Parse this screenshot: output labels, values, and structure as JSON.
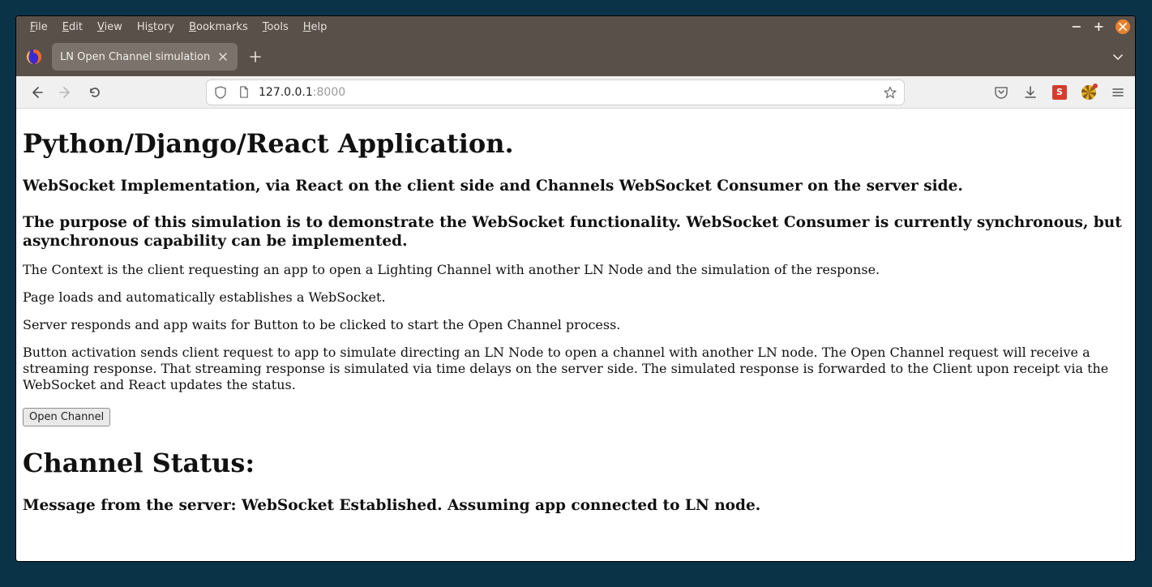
{
  "menu": {
    "file": "File",
    "edit": "Edit",
    "view": "View",
    "history": "History",
    "bookmarks": "Bookmarks",
    "tools": "Tools",
    "help": "Help"
  },
  "window_controls": {
    "minimize": "−",
    "maximize": "+"
  },
  "tab": {
    "title": "LN Open Channel simulation"
  },
  "url": {
    "host": "127.0.0.1",
    "port": ":8000"
  },
  "page": {
    "h1": "Python/Django/React Application.",
    "h3a": "WebSocket Implementation, via React on the client side and Channels WebSocket Consumer on the server side.",
    "h3b": "The purpose of this simulation is to demonstrate the WebSocket functionality. WebSocket Consumer is currently synchronous, but asynchronous capability can be implemented.",
    "p1": "The Context is the client requesting an app to open a Lighting Channel with another LN Node and the simulation of the response.",
    "p2": "Page loads and automatically establishes a WebSocket.",
    "p3": "Server responds and app waits for Button to be clicked to start the Open Channel process.",
    "p4": "Button activation sends client request to app to simulate directing an LN Node to open a channel with another LN node. The Open Channel request will receive a streaming response. That streaming response is simulated via time delays on the server side. The simulated response is forwarded to the Client upon receipt via the WebSocket and React updates the status.",
    "button_label": "Open Channel",
    "status_heading": "Channel Status:",
    "status_msg": "Message from the server: WebSocket Established. Assuming app connected to LN node."
  }
}
